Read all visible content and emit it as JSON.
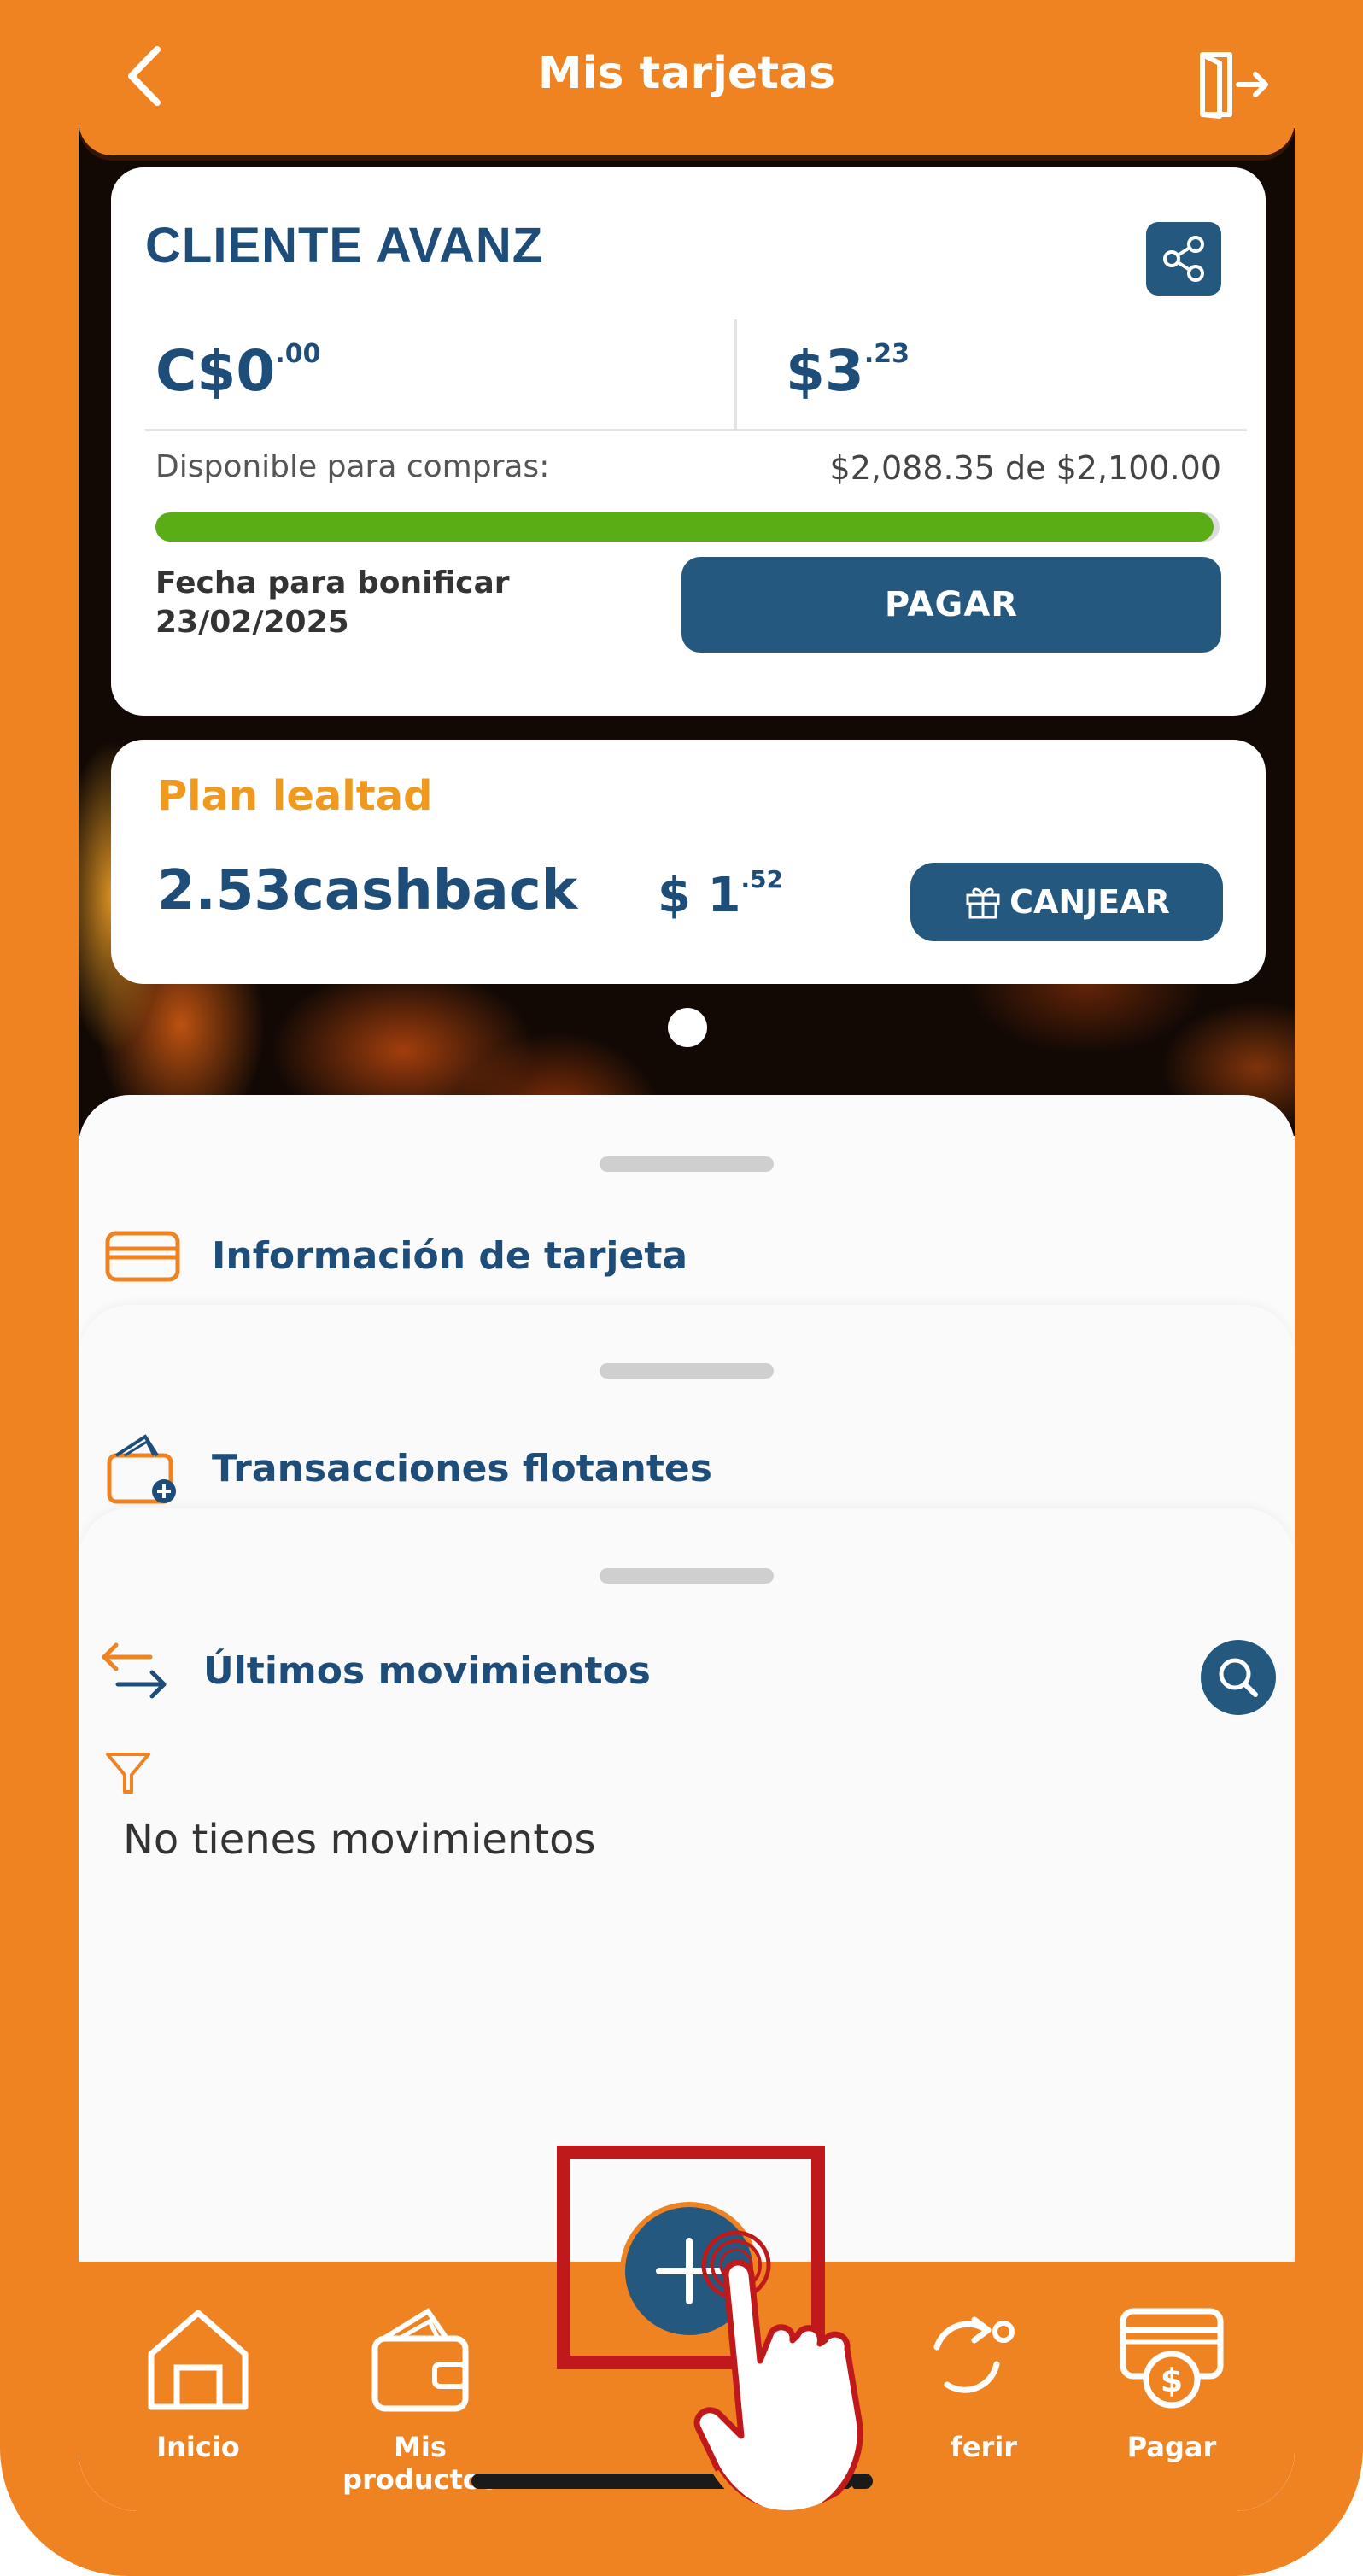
{
  "header": {
    "title": "Mis tarjetas",
    "back_icon": "chevron-left-icon",
    "logout_icon": "logout-icon"
  },
  "card": {
    "client_name": "CLIENTE AVANZ",
    "balance_local": {
      "main": "C$0",
      "cents": ".00"
    },
    "balance_usd": {
      "main": "$3",
      "cents": ".23"
    },
    "available_label": "Disponible para compras:",
    "available_value": "$2,088.35 de $2,100.00",
    "available_fraction": 0.9945,
    "bonus_date_label": "Fecha para bonificar",
    "bonus_date": "23/02/2025",
    "pay_button": "PAGAR"
  },
  "loyalty": {
    "title": "Plan lealtad",
    "cashback": "2.53cashback",
    "amount": {
      "main": "$ 1",
      "cents": ".52"
    },
    "redeem_button": "CANJEAR"
  },
  "sheets": {
    "card_info": "Información de tarjeta",
    "floating_tx": "Transacciones flotantes",
    "last_movements": "Últimos movimientos",
    "empty_message": "No tienes movimientos"
  },
  "nav": {
    "items": [
      {
        "label": "Inicio",
        "icon": "home-icon"
      },
      {
        "label": "Mis productos",
        "icon": "wallet-icon"
      },
      {
        "label": "ferir",
        "icon": "transfer-icon"
      },
      {
        "label": "Pagar",
        "icon": "pay-icon"
      }
    ]
  },
  "colors": {
    "brand_orange": "#ef8322",
    "navy": "#24587f",
    "text_blue": "#1d4d78",
    "progress_green": "#5aad14",
    "loyalty_orange": "#ef9a1f",
    "highlight_red": "#c0191c"
  }
}
